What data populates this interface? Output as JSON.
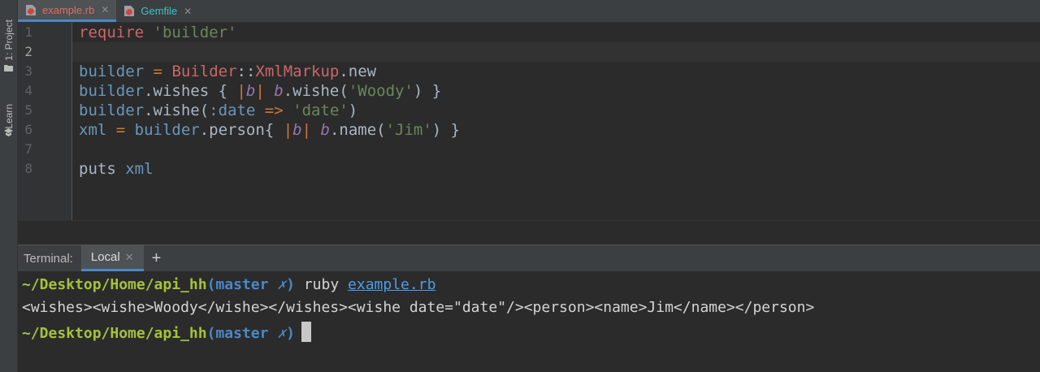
{
  "sidebar": {
    "project_label": "1: Project",
    "learn_label": "Learn"
  },
  "tabs": [
    {
      "label": "example.rb",
      "color": "#e06c60"
    },
    {
      "label": "Gemfile",
      "color": "#3fc1c9"
    }
  ],
  "editor": {
    "line_numbers": [
      "1",
      "2",
      "3",
      "4",
      "5",
      "6",
      "7",
      "8"
    ],
    "lines": {
      "l1": {
        "kw": "require",
        "str": "'builder'"
      },
      "l3": {
        "a": "builder",
        "op": "=",
        "cls1": "Builder",
        "sep": "::",
        "cls2": "XmlMarkup",
        "m": ".new"
      },
      "l4": {
        "a": "builder",
        "m": ".wishes { ",
        "p1": "|",
        "b": "b",
        "p2": "|",
        "sp": " ",
        "b2": "b",
        "m2": ".wishe(",
        "s": "'Woody'",
        "e": ") }"
      },
      "l5": {
        "a": "builder",
        "m": ".wishe(",
        "sym": ":date",
        "op": " =>",
        "s": " 'date'",
        "e": ")"
      },
      "l6": {
        "a": "xml",
        "op": " = ",
        "b": "builder",
        "m": ".person{ ",
        "p1": "|",
        "bv": "b",
        "p2": "|",
        "sp": " ",
        "b2": "b",
        "m2": ".name(",
        "s": "'Jim'",
        "e": ") }"
      },
      "l8": {
        "a": "puts",
        "v": " xml"
      }
    }
  },
  "terminal": {
    "label": "Terminal:",
    "tab_label": "Local",
    "add": "+",
    "prompt_path": "~/Desktop/Home/api_hh",
    "paren_open": "(",
    "branch": "master",
    "dirty": "✗",
    "paren_close": ")",
    "command": "ruby",
    "file": "example.rb",
    "output": "<wishes><wishe>Woody</wishe></wishes><wishe date=\"date\"/><person><name>Jim</name></person>"
  }
}
